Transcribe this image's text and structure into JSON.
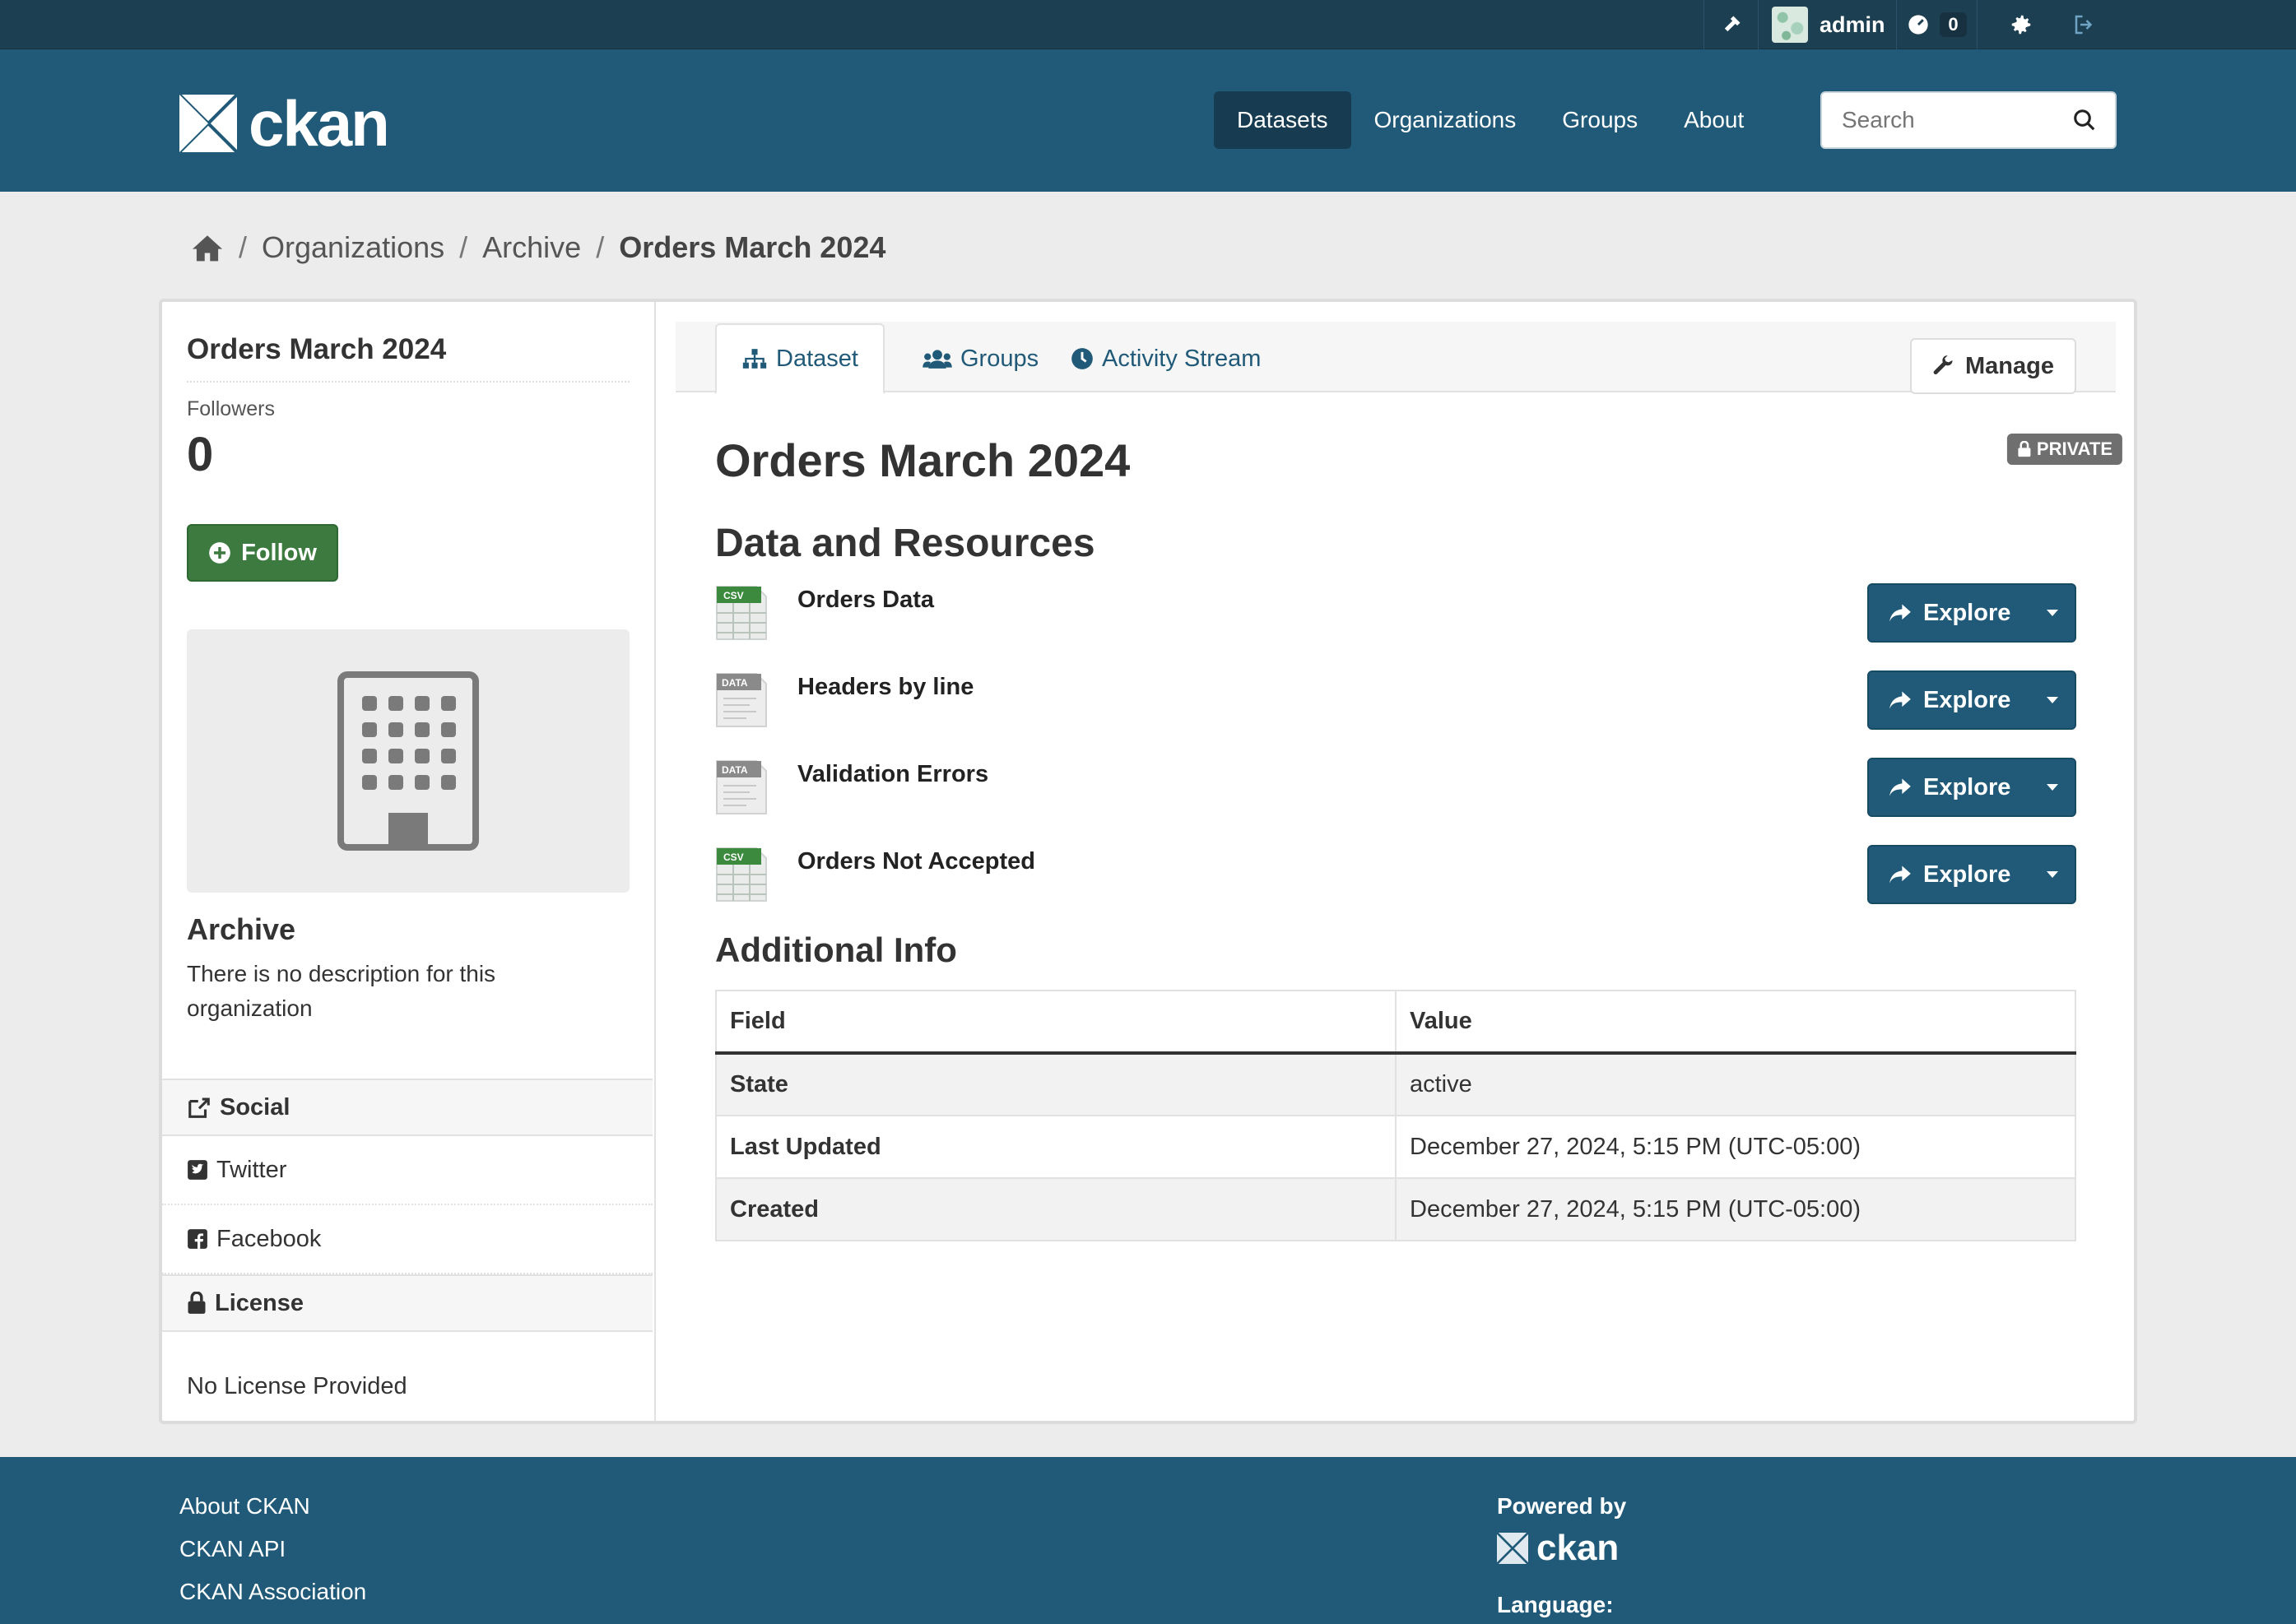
{
  "account": {
    "username": "admin",
    "activity_count": "0"
  },
  "masthead": {
    "logo_text": "ckan",
    "nav": [
      {
        "label": "Datasets",
        "active": true
      },
      {
        "label": "Organizations",
        "active": false
      },
      {
        "label": "Groups",
        "active": false
      },
      {
        "label": "About",
        "active": false
      }
    ],
    "search_placeholder": "Search"
  },
  "breadcrumb": {
    "items": [
      "Organizations",
      "Archive"
    ],
    "current": "Orders March 2024"
  },
  "sidebar": {
    "title": "Orders March 2024",
    "followers_label": "Followers",
    "followers_count": "0",
    "follow_label": "Follow",
    "org_name": "Archive",
    "org_description": "There is no description for this organization",
    "social_heading": "Social",
    "social_links": [
      "Twitter",
      "Facebook"
    ],
    "license_heading": "License",
    "license_text": "No License Provided"
  },
  "tabs": [
    {
      "label": "Dataset",
      "icon": "sitemap-icon",
      "active": true
    },
    {
      "label": "Groups",
      "icon": "users-icon",
      "active": false
    },
    {
      "label": "Activity Stream",
      "icon": "clock-icon",
      "active": false
    }
  ],
  "manage_label": "Manage",
  "dataset": {
    "title": "Orders March 2024",
    "private_label": "PRIVATE",
    "resources_heading": "Data and Resources",
    "resources": [
      {
        "name": "Orders Data",
        "format": "CSV",
        "explore": "Explore"
      },
      {
        "name": "Headers by line",
        "format": "DATA",
        "explore": "Explore"
      },
      {
        "name": "Validation Errors",
        "format": "DATA",
        "explore": "Explore"
      },
      {
        "name": "Orders Not Accepted",
        "format": "CSV",
        "explore": "Explore"
      }
    ],
    "additional_info_heading": "Additional Info",
    "table_headers": [
      "Field",
      "Value"
    ],
    "table_rows": [
      {
        "field": "State",
        "value": "active"
      },
      {
        "field": "Last Updated",
        "value": "December 27, 2024, 5:15 PM (UTC-05:00)"
      },
      {
        "field": "Created",
        "value": "December 27, 2024, 5:15 PM (UTC-05:00)"
      }
    ]
  },
  "footer": {
    "links": [
      "About CKAN",
      "CKAN API",
      "CKAN Association"
    ],
    "powered_by": "Powered by",
    "powered_logo": "ckan",
    "language_label": "Language:"
  },
  "colors": {
    "masthead": "#205a78",
    "account_bar": "#1d3f52",
    "follow_button": "#3d7a3f",
    "csv_green": "#3b8a3e"
  }
}
